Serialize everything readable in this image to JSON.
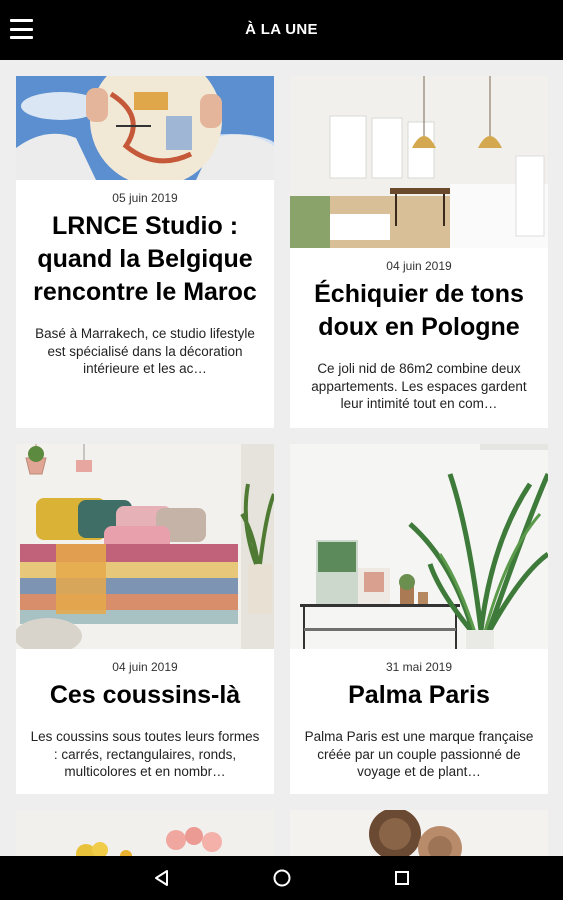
{
  "header": {
    "title": "À LA UNE",
    "menu_icon": "hamburger-menu-icon"
  },
  "articles": [
    {
      "date": "05 juin 2019",
      "title": "LRNCE Studio : quand la Belgique rencontre le Maroc",
      "excerpt": "Basé à Marrakech, ce studio lifestyle est spécialisé dans la décoration intérieure et les ac…"
    },
    {
      "date": "04 juin 2019",
      "title": "Échiquier de tons doux en Pologne",
      "excerpt": "Ce joli nid de 86m2 combine deux appartements. Les espaces gardent leur intimité tout en com…"
    },
    {
      "date": "04 juin 2019",
      "title": "Ces coussins-là",
      "excerpt": "Les coussins sous toutes leurs formes : carrés, rectangulaires, ronds, multicolores et en nombr…"
    },
    {
      "date": "31 mai 2019",
      "title": "Palma Paris",
      "excerpt": "Palma Paris est une marque française créée par un couple passionné de voyage et de plant…"
    }
  ],
  "nav": {
    "back_icon": "back-triangle-icon",
    "home_icon": "home-circle-icon",
    "recents_icon": "recents-square-icon"
  }
}
